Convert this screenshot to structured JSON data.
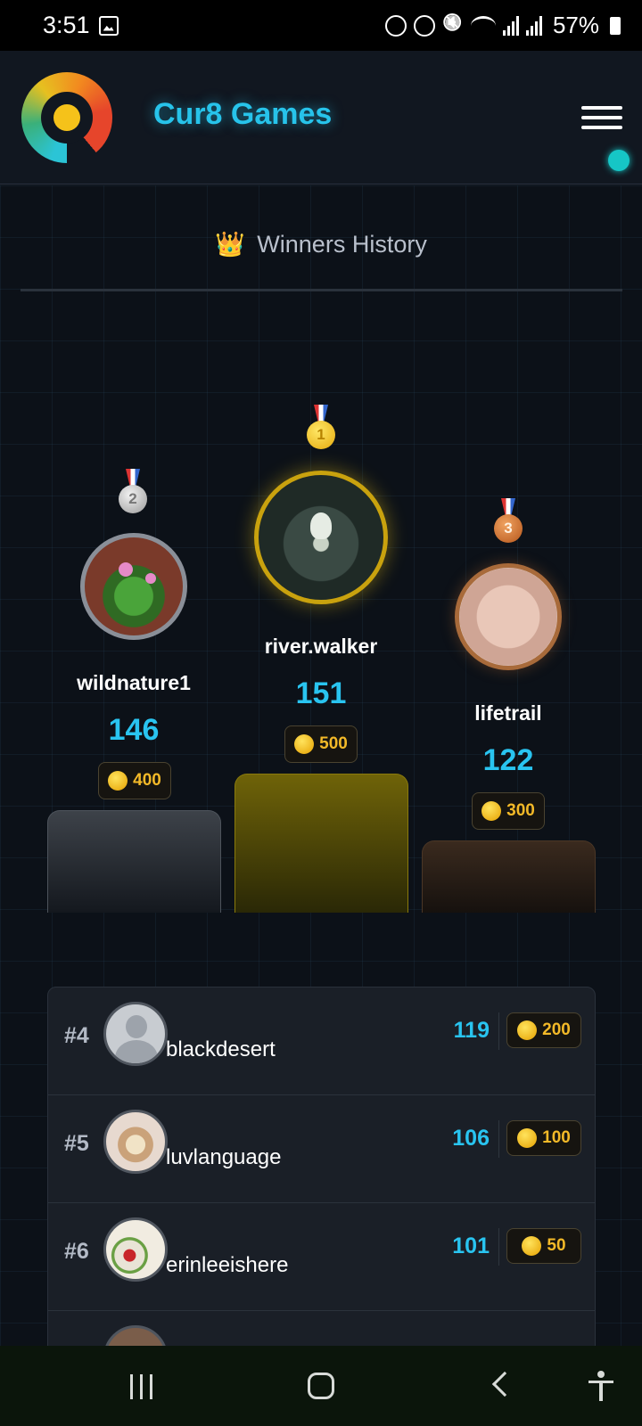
{
  "status_bar": {
    "time": "3:51",
    "battery": "57%",
    "icons": [
      "gallery-icon",
      "recycle-icon",
      "alarm-icon",
      "mute-icon",
      "wifi-icon",
      "signal-icon",
      "signal-icon",
      "battery-icon"
    ]
  },
  "header": {
    "title": "Cur8 Games",
    "logo": "cur8-logo",
    "menu_icon": "hamburger-menu-icon",
    "accent_color": "#27c3ea"
  },
  "section": {
    "icon": "👑",
    "title": "Winners History"
  },
  "podium": [
    {
      "place": 2,
      "medal": "2",
      "name": "wildnature1",
      "score": "146",
      "coins": "400",
      "avatar": "plant-photo"
    },
    {
      "place": 1,
      "medal": "1",
      "name": "river.walker",
      "score": "151",
      "coins": "500",
      "avatar": "forest-spirit-photo"
    },
    {
      "place": 3,
      "medal": "3",
      "name": "lifetrail",
      "score": "122",
      "coins": "300",
      "avatar": "hands-photo"
    }
  ],
  "leaderboard": [
    {
      "rank": "#4",
      "name": "blackdesert",
      "score": "119",
      "coins": "200",
      "avatar": "default-avatar"
    },
    {
      "rank": "#5",
      "name": "luvlanguage",
      "score": "106",
      "coins": "100",
      "avatar": "person-photo"
    },
    {
      "rank": "#6",
      "name": "erinleeishere",
      "score": "101",
      "coins": "50",
      "avatar": "food-photo"
    },
    {
      "rank": "",
      "name": "",
      "score": "",
      "coins": "",
      "avatar": "partial-photo"
    }
  ],
  "colors": {
    "score": "#29c4f0",
    "coin": "#f3b928",
    "gold": "#c9a20e",
    "silver": "#8a8f98",
    "bronze": "#a86a3a"
  },
  "nav_bar": [
    "recents-icon",
    "home-icon",
    "back-icon",
    "accessibility-icon"
  ]
}
